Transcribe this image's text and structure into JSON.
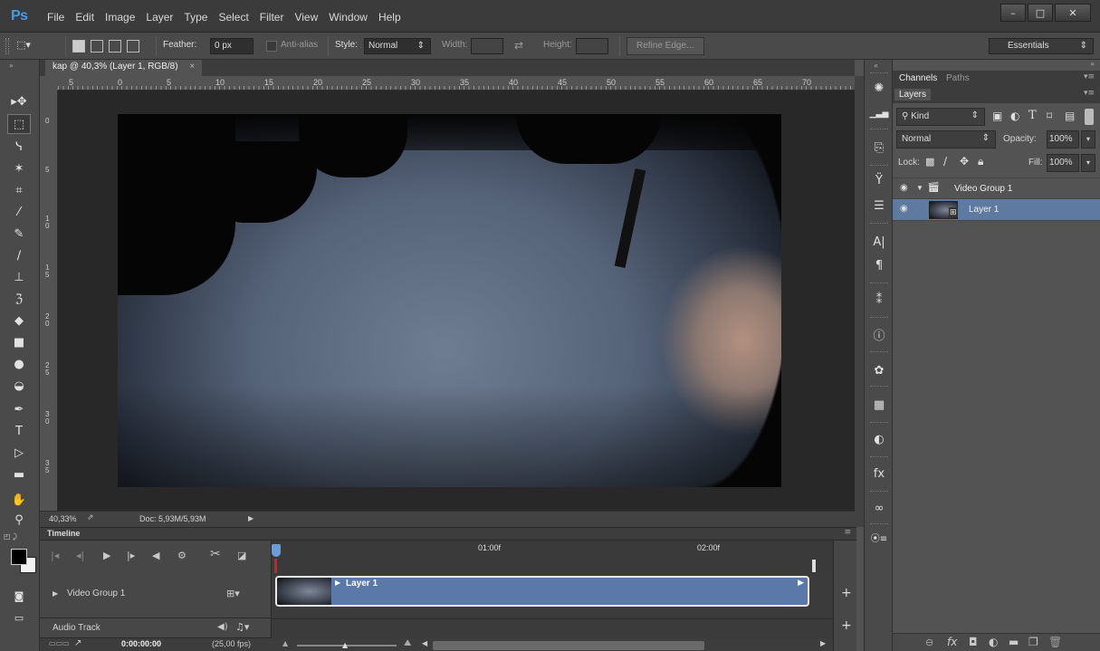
{
  "app": {
    "logo": "Ps"
  },
  "menu": [
    "File",
    "Edit",
    "Image",
    "Layer",
    "Type",
    "Select",
    "Filter",
    "View",
    "Window",
    "Help"
  ],
  "window_controls": {
    "minimize": "–",
    "maximize": "□",
    "close": "✕"
  },
  "options": {
    "feather_label": "Feather:",
    "feather_value": "0 px",
    "antialias_label": "Anti-alias",
    "style_label": "Style:",
    "style_value": "Normal",
    "width_label": "Width:",
    "height_label": "Height:",
    "refine_edge": "Refine Edge...",
    "workspace": "Essentials"
  },
  "document": {
    "tab_title": "kap @ 40,3% (Layer 1, RGB/8)",
    "tab_close": "×",
    "zoom": "40,33%",
    "doc_size": "Doc: 5,93M/5,93M"
  },
  "ruler_top": [
    "5",
    "0",
    "5",
    "10",
    "15",
    "20",
    "25",
    "30",
    "35",
    "40",
    "45",
    "50",
    "55",
    "60",
    "65",
    "70"
  ],
  "ruler_left": [
    "0",
    "5",
    "1 0",
    "1 5",
    "2 0",
    "2 5",
    "3 0",
    "3 5"
  ],
  "timeline": {
    "title": "Timeline",
    "marks": [
      "01:00f",
      "02:00f"
    ],
    "tracks": {
      "video_group": "Video Group 1",
      "audio": "Audio Track"
    },
    "clip_name": "Layer 1",
    "timecode": "0:00:00:00",
    "fps": "(25,00 fps)"
  },
  "panels": {
    "tabs_top": [
      "Channels",
      "Paths"
    ],
    "tab_layers": "Layers",
    "kind": "Kind",
    "blend_mode": "Normal",
    "opacity_label": "Opacity:",
    "opacity_value": "100%",
    "lock_label": "Lock:",
    "fill_label": "Fill:",
    "fill_value": "100%",
    "layers": [
      {
        "name": "Video Group 1",
        "type": "group"
      },
      {
        "name": "Layer 1",
        "type": "video-layer",
        "selected": true
      }
    ]
  },
  "colors": {
    "accent_blue": "#3d9bf0",
    "clip_blue": "#5a79a8",
    "selected_layer": "#5f7aa0"
  }
}
